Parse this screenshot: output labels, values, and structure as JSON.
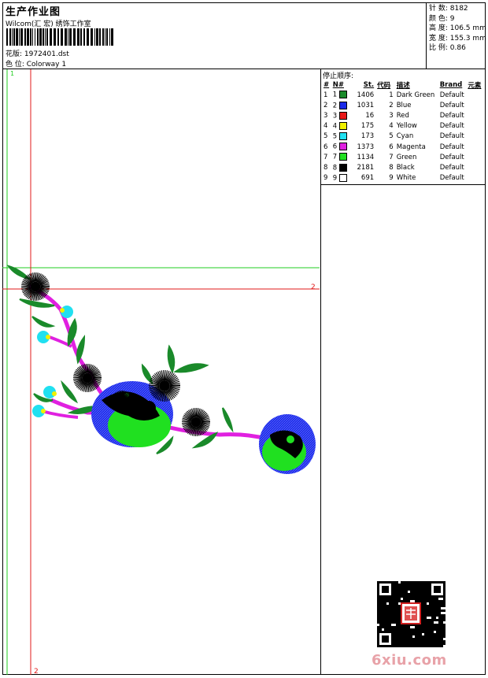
{
  "header": {
    "title": "生产作业图",
    "company": "Wilcom(汇 宏) 绣饰工作室",
    "pattern_label": "花版: 1972401.dst",
    "colorway_label": "色 位: Colorway 1"
  },
  "stats": {
    "stitches": "针 数: 8182",
    "colors": "颜 色: 9",
    "height": "高 度: 106.5 mm",
    "width": "宽 度: 155.3 mm",
    "scale": "比 例: 0.86"
  },
  "legend": {
    "caption": "停止顺序:",
    "headers": [
      "#",
      "N#",
      "St.",
      "代码",
      "描述",
      "Brand",
      "元素"
    ],
    "rows": [
      {
        "idx": "1",
        "n": "1",
        "color": "#1a8a2a",
        "stitches": "1406",
        "code": "1",
        "desc": "Dark Green",
        "brand": "Default"
      },
      {
        "idx": "2",
        "n": "2",
        "color": "#1a2ae8",
        "stitches": "1031",
        "code": "2",
        "desc": "Blue",
        "brand": "Default"
      },
      {
        "idx": "3",
        "n": "3",
        "color": "#e81818",
        "stitches": "16",
        "code": "3",
        "desc": "Red",
        "brand": "Default"
      },
      {
        "idx": "4",
        "n": "4",
        "color": "#f0f000",
        "stitches": "175",
        "code": "4",
        "desc": "Yellow",
        "brand": "Default"
      },
      {
        "idx": "5",
        "n": "5",
        "color": "#20e0f0",
        "stitches": "173",
        "code": "5",
        "desc": "Cyan",
        "brand": "Default"
      },
      {
        "idx": "6",
        "n": "6",
        "color": "#e020e0",
        "stitches": "1373",
        "code": "6",
        "desc": "Magenta",
        "brand": "Default"
      },
      {
        "idx": "7",
        "n": "7",
        "color": "#20e020",
        "stitches": "1134",
        "code": "7",
        "desc": "Green",
        "brand": "Default"
      },
      {
        "idx": "8",
        "n": "8",
        "color": "#000000",
        "stitches": "2181",
        "code": "8",
        "desc": "Black",
        "brand": "Default"
      },
      {
        "idx": "9",
        "n": "9",
        "color": "#ffffff",
        "stitches": "691",
        "code": "9",
        "desc": "White",
        "brand": "Default"
      }
    ]
  },
  "guides": {
    "marker_1": "1",
    "marker_2_h": "2",
    "marker_2_v": "2"
  },
  "colors": {
    "guide_green": "#22cc22",
    "guide_red": "#e01818"
  },
  "watermark": {
    "text": "6xiu.com",
    "qr_icon": "qr-code-icon",
    "seal_icon": "red-seal-icon"
  }
}
